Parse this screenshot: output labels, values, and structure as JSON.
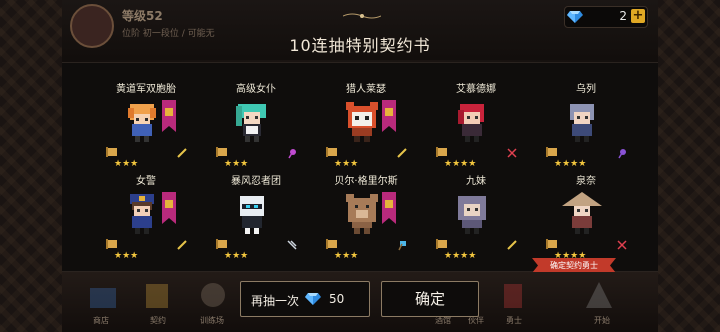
{
  "header": {
    "level_text": "等级52",
    "sub_text": "位阶 初一段位 / 可能无",
    "title": "10连抽特别契约书",
    "gem_count": "2",
    "plus_label": "+"
  },
  "colors": {
    "star": "#f3c63e",
    "banner": "#b92a7c",
    "badge": "#c23a2a",
    "panel": "#0f0d0c"
  },
  "cards": [
    {
      "name": "黄道军双胞胎",
      "stars": "★★★",
      "icon": "twins-sprite"
    },
    {
      "name": "高级女仆",
      "stars": "★★★",
      "icon": "maid-sprite"
    },
    {
      "name": "猎人莱瑟",
      "stars": "★★★",
      "icon": "red-panda-sprite"
    },
    {
      "name": "艾慕德娜",
      "stars": "★★★★",
      "icon": "red-hair-sprite"
    },
    {
      "name": "乌列",
      "stars": "★★★★",
      "icon": "gray-hair-sprite"
    },
    {
      "name": "女警",
      "stars": "★★★",
      "icon": "police-sprite"
    },
    {
      "name": "暴风忍者团",
      "stars": "★★★",
      "icon": "ninja-sprite"
    },
    {
      "name": "贝尔·格里尔斯",
      "stars": "★★★",
      "icon": "bear-sprite"
    },
    {
      "name": "九妹",
      "stars": "★★★★",
      "icon": "hooded-sprite"
    },
    {
      "name": "泉奈",
      "stars": "★★★★",
      "icon": "straw-hat-sprite"
    }
  ],
  "badge": {
    "text": "确定契约勇士"
  },
  "buttons": {
    "again_label": "再抽一次",
    "again_cost": "50",
    "confirm_label": "确定"
  },
  "bottom_nav": [
    "商店",
    "契约",
    "训练场",
    "酒馆",
    "伙伴",
    "勇士",
    "开始"
  ]
}
